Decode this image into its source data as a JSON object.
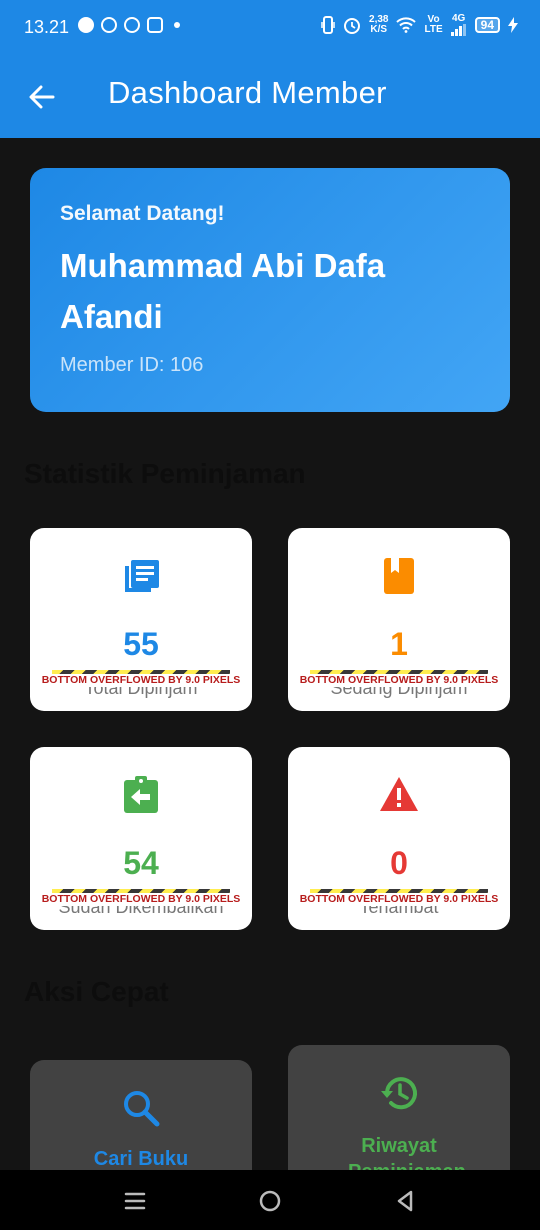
{
  "status_bar": {
    "time": "13.21",
    "speed_value": "2,38",
    "speed_unit": "K/S",
    "network_vo": "Vo",
    "network_lte": "LTE",
    "network_4g": "4G",
    "battery": "94"
  },
  "app_bar": {
    "title": "Dashboard Member",
    "back_icon": "arrow-back-icon"
  },
  "welcome": {
    "greeting": "Selamat Datang!",
    "name": "Muhammad Abi Dafa Afandi",
    "member_id": "Member ID: 106"
  },
  "stats_section": {
    "title": "Statistik Peminjaman",
    "overflow_warning": "BOTTOM OVERFLOWED BY 9.0 PIXELS",
    "cards": [
      {
        "icon": "library-books-icon",
        "value": "55",
        "label": "Total Dipinjam",
        "color": "#1e88e5"
      },
      {
        "icon": "book-icon",
        "value": "1",
        "label": "Sedang Dipinjam",
        "color": "#fb8c00"
      },
      {
        "icon": "assignment-return-icon",
        "value": "54",
        "label": "Sudah Dikembalikan",
        "color": "#4caf50"
      },
      {
        "icon": "warning-icon",
        "value": "0",
        "label": "Terlambat",
        "color": "#e53935"
      }
    ]
  },
  "actions_section": {
    "title": "Aksi Cepat",
    "actions": [
      {
        "icon": "search-icon",
        "label": "Cari Buku",
        "color": "#1e88e5"
      },
      {
        "icon": "history-icon",
        "label": "Riwayat Peminjaman",
        "color": "#4caf50"
      }
    ]
  },
  "nav_bar": {
    "icons": [
      "recent-apps-icon",
      "home-icon",
      "back-triangle-icon"
    ]
  }
}
